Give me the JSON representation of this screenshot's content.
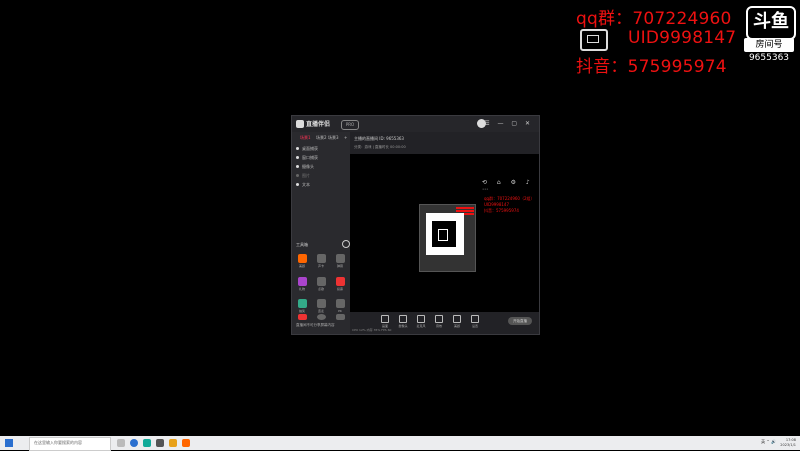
{
  "overlay": {
    "qq": "qq群：707224960（2组）",
    "uid": "UID9998147",
    "douyin": "抖音：575995974",
    "logo_big": "斗鱼",
    "logo_tag": "房间号",
    "room_number": "9655363"
  },
  "app": {
    "brand": "直播伴侣",
    "badge": "PRO",
    "tabs": [
      "场景1",
      "场景2",
      "场景3",
      "+"
    ],
    "scenes": [
      "桌面捕获",
      "窗口捕获",
      "摄像头",
      "图片",
      "文本"
    ],
    "tools_title": "工具箱",
    "tools": [
      "美颜",
      "声卡",
      "弹幕",
      "礼物",
      "点歌",
      "投票",
      "抽奖",
      "连麦",
      "PK",
      "商品",
      "更多",
      "设置"
    ],
    "bottom_left_text": "直播间不可分享屏幕内容",
    "main_title": "主播的直播间 ID: 9655363",
    "main_sub": "分类：游戏  |  直播时长 00:00:00",
    "bottom_tools": [
      "画面",
      "摄像头",
      "麦克风",
      "音效",
      "美颜",
      "设置"
    ],
    "start_live": "开始直播",
    "status": "CPU 12%   内存 35%   FPS 60"
  },
  "mini_overlay": [
    "qq群：707224960（2组）",
    "UID9998147",
    "抖音：575995974"
  ],
  "taskbar": {
    "search_placeholder": "在这里输入你要搜索的内容",
    "tray": "英  ⌃  🔊",
    "time": "17:08",
    "date": "2023/1/1"
  },
  "colors": {
    "overlay_red": "#e11111",
    "desktop": "#000000",
    "app_bg": "#1f1f22",
    "accent": "#ff3355"
  }
}
